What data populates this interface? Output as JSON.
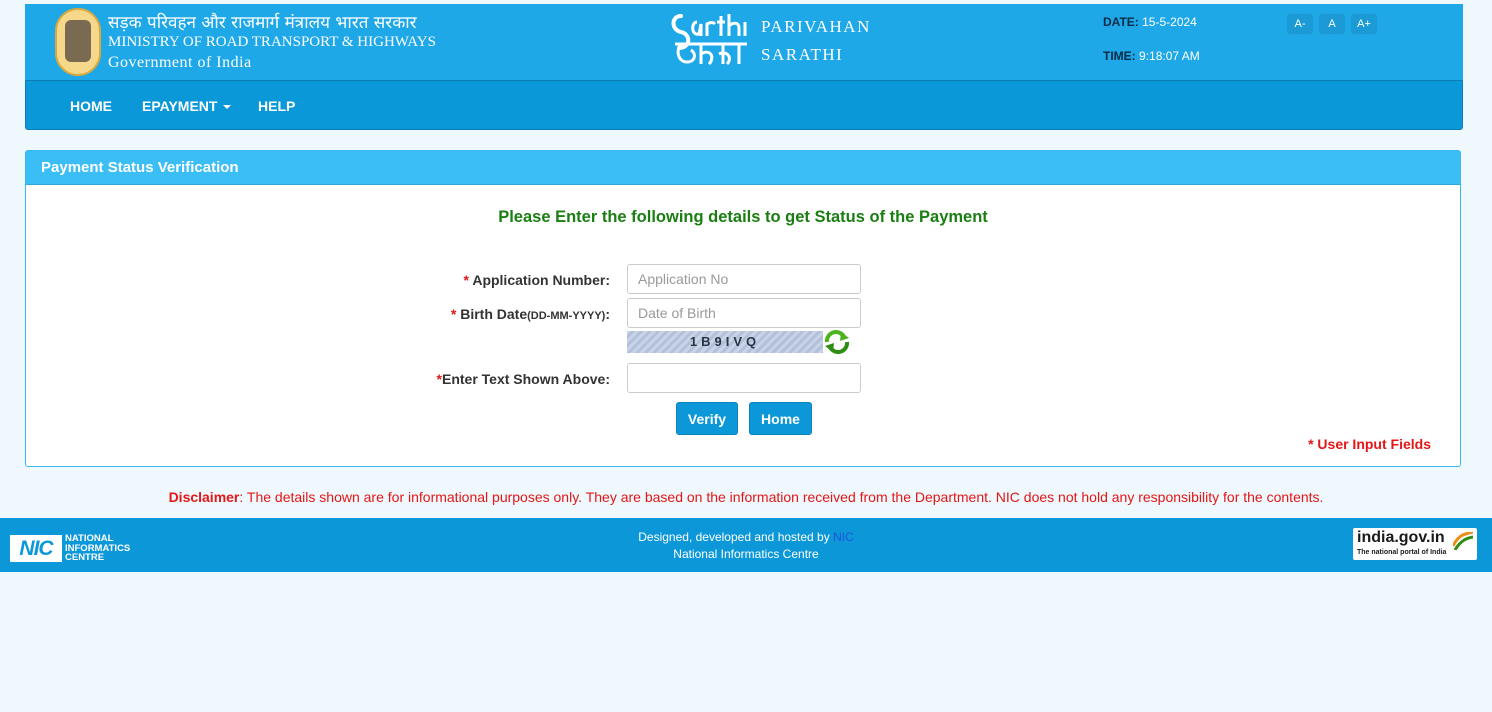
{
  "header": {
    "hindi_title": "सड़क परिवहन और राजमार्ग मंत्रालय भारत सरकार",
    "ministry": "MINISTRY OF ROAD TRANSPORT & HIGHWAYS",
    "government": "Government of India",
    "brand_line1": "PARIVAHAN",
    "brand_line2": "SARATHI",
    "date_label": "DATE:",
    "date_value": "15-5-2024",
    "time_label": "TIME:",
    "time_value": "9:18:07 AM",
    "font_sizes": [
      "A-",
      "A",
      "A+"
    ]
  },
  "nav": {
    "home": "HOME",
    "epayment": "EPAYMENT",
    "help": "HELP"
  },
  "panel": {
    "title": "Payment Status Verification",
    "instruction": "Please Enter the following details to get Status of the Payment",
    "required_mark": "*",
    "app_no_label": "Application Number:",
    "app_no_placeholder": "Application No",
    "dob_label": "Birth Date",
    "dob_format": "(DD-MM-YYYY)",
    "dob_colon": ":",
    "dob_placeholder": "Date of Birth",
    "captcha_text": "1B9IVQ",
    "captcha_label": "Enter Text Shown Above:",
    "captcha_input_value": "",
    "verify_button": "Verify",
    "home_button": "Home",
    "user_input_note": "* User Input Fields"
  },
  "disclaimer": {
    "label": "Disclaimer",
    "text": ": The details shown are for informational purposes only. They are based on the information received from the Department. NIC does not hold any responsibility for the contents."
  },
  "footer": {
    "nic_abbr": "NIC",
    "nic_line1": "NATIONAL",
    "nic_line2": "INFORMATICS",
    "nic_line3": "CENTRE",
    "designed_by": "Designed, developed and hosted by",
    "designed_link": "NIC",
    "org_name": "National Informatics Centre",
    "india_gov": "india.gov.in",
    "india_gov_tag": "The national portal of India"
  },
  "colors": {
    "header_blue": "#1ea8e8",
    "nav_blue": "#0b98d8",
    "panel_head": "#3bbef5",
    "instruction_green": "#1a7e12",
    "required_red": "#e41616"
  },
  "icons": {
    "emblem": "national-emblem-icon",
    "refresh": "refresh-captcha-icon",
    "dropdown": "caret-down-icon"
  }
}
